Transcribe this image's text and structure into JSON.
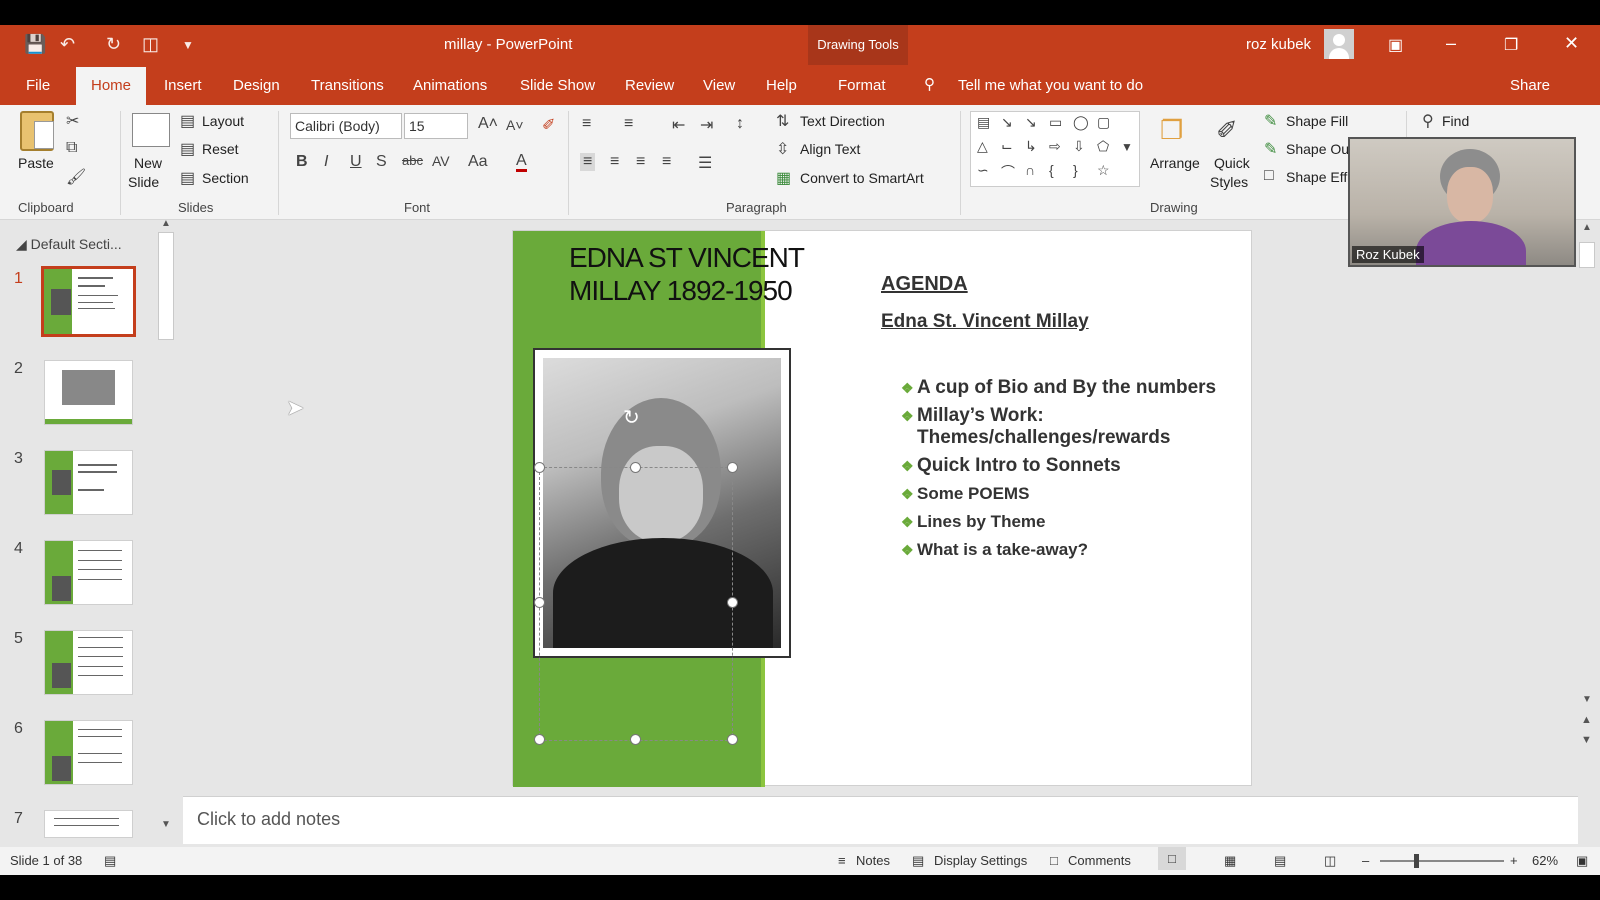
{
  "titlebar": {
    "title": "millay  -  PowerPoint",
    "context_tab": "Drawing Tools",
    "user": "roz kubek"
  },
  "tabs": [
    "File",
    "Home",
    "Insert",
    "Design",
    "Transitions",
    "Animations",
    "Slide Show",
    "Review",
    "View",
    "Help",
    "Format"
  ],
  "active_tab": "Home",
  "tell_me": "Tell me what you want to do",
  "share": "Share",
  "ribbon": {
    "clipboard": {
      "paste": "Paste",
      "label": "Clipboard"
    },
    "slides": {
      "new_slide": "New",
      "new_slide2": "Slide",
      "layout": "Layout",
      "reset": "Reset",
      "section": "Section",
      "label": "Slides"
    },
    "font": {
      "face": "Calibri (Body)",
      "size": "15",
      "label": "Font"
    },
    "paragraph": {
      "text_direction": "Text Direction",
      "align_text": "Align Text",
      "convert": "Convert to SmartArt",
      "label": "Paragraph"
    },
    "drawing": {
      "arrange": "Arrange",
      "quick": "Quick",
      "styles": "Styles",
      "shape_fill": "Shape Fill",
      "shape_outline": "Shape Ou",
      "shape_effects": "Shape Eff",
      "label": "Drawing"
    },
    "editing": {
      "find": "Find"
    }
  },
  "panel": {
    "section": "Default Secti...",
    "slides": [
      "1",
      "2",
      "3",
      "4",
      "5",
      "6",
      "7"
    ],
    "selected": "1"
  },
  "slide": {
    "title_line1": "EDNA ST VINCENT",
    "title_line2": "MILLAY 1892-1950",
    "agenda": "AGENDA",
    "subtitle": "Edna St. Vincent Millay",
    "bullets": [
      "A cup of Bio and By the numbers",
      "Millay’s Work: Themes/challenges/rewards",
      "Quick Intro to Sonnets",
      "Some POEMS",
      "Lines by Theme",
      "What is a take-away?"
    ]
  },
  "notes_placeholder": "Click to add notes",
  "webcam_name": "Roz Kubek",
  "status": {
    "slide": "Slide 1 of 38",
    "notes": "Notes",
    "display": "Display Settings",
    "comments": "Comments",
    "zoom": "62%"
  },
  "colors": {
    "brand": "#c43e1c",
    "slide_green": "#6aaa3a"
  }
}
